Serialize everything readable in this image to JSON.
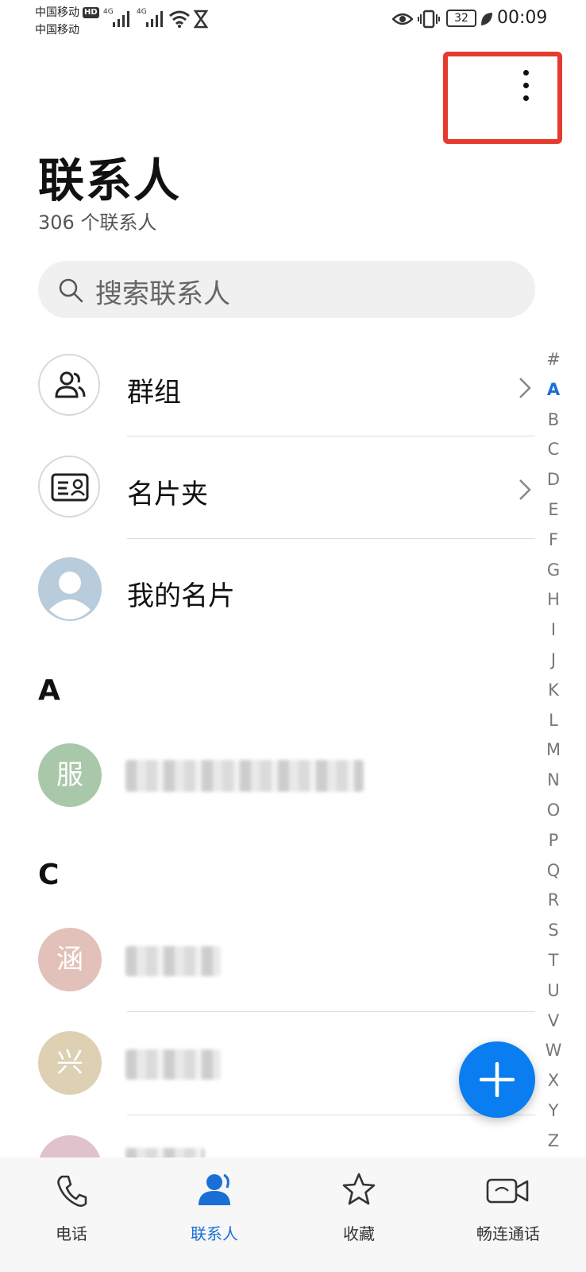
{
  "status_bar": {
    "carrier_1": "中国移动",
    "carrier_2": "中国移动",
    "hd_badge": "HD",
    "signal_1": "4G",
    "signal_2": "4G",
    "battery": "32",
    "time": "00:09"
  },
  "header": {
    "title": "联系人",
    "count": "306 个联系人"
  },
  "search": {
    "placeholder": "搜索联系人"
  },
  "list": {
    "groups_label": "群组",
    "cards_label": "名片夹",
    "my_card_label": "我的名片"
  },
  "sections": [
    {
      "letter": "A",
      "contacts": [
        {
          "avatar_char": "服",
          "avatar_color": "#a9c8a9"
        }
      ]
    },
    {
      "letter": "C",
      "contacts": [
        {
          "avatar_char": "涵",
          "avatar_color": "#e2c1ba"
        },
        {
          "avatar_char": "兴",
          "avatar_color": "#ddd0b3"
        }
      ]
    }
  ],
  "index_letters": [
    "#",
    "A",
    "B",
    "C",
    "D",
    "E",
    "F",
    "G",
    "H",
    "I",
    "J",
    "K",
    "L",
    "M",
    "N",
    "O",
    "P",
    "Q",
    "R",
    "S",
    "T",
    "U",
    "V",
    "W",
    "X",
    "Y",
    "Z"
  ],
  "index_active": "A",
  "bottom_nav": {
    "phone": "电话",
    "contacts": "联系人",
    "favorites": "收藏",
    "meetime": "畅连通话"
  },
  "colors": {
    "accent": "#1a6fd6",
    "fab": "#0a7df0",
    "highlight_box": "#e53b2f"
  }
}
